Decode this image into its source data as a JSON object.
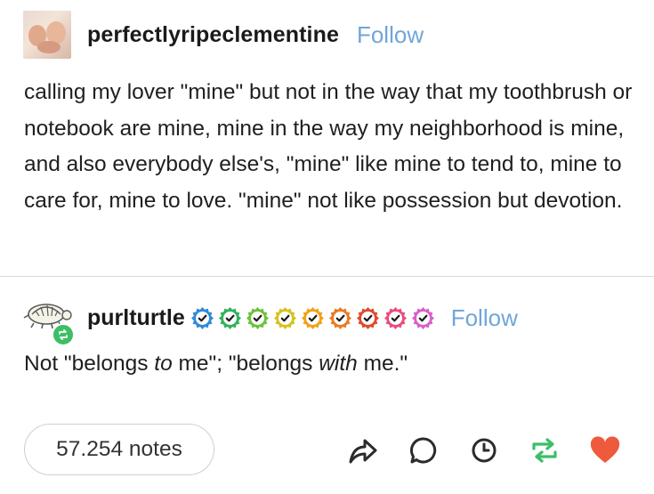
{
  "original_post": {
    "username": "perfectlyripeclementine",
    "follow_label": "Follow",
    "body": "calling my lover \"mine\" but not in the way that my toothbrush or notebook are mine, mine in the way my neighborhood is mine, and also everybody else's, \"mine\" like mine to tend to, mine to care for, mine to love. \"mine\" not like possession but devotion."
  },
  "reblog": {
    "username": "purlturtle",
    "follow_label": "Follow",
    "text_before": "Not \"belongs ",
    "text_italic_1": "to",
    "text_middle": " me\"; \"belongs ",
    "text_italic_2": "with",
    "text_after": " me.\"",
    "badge_colors": [
      "#2f8ad8",
      "#2fb35a",
      "#6cc23a",
      "#d6c21e",
      "#f0a21a",
      "#ec7a22",
      "#e14a2b",
      "#ea4d7d",
      "#d960c9"
    ]
  },
  "footer": {
    "notes_label": "57.254 notes",
    "icons": [
      "share-icon",
      "reply-icon",
      "history-icon",
      "reblog-icon",
      "like-icon"
    ],
    "colors": {
      "reblog": "#3cbf65",
      "like": "#ee5a3b",
      "icon_default": "#2b2b2b"
    }
  },
  "colors": {
    "follow": "#6fa6d9",
    "divider": "#d8d8d8"
  }
}
